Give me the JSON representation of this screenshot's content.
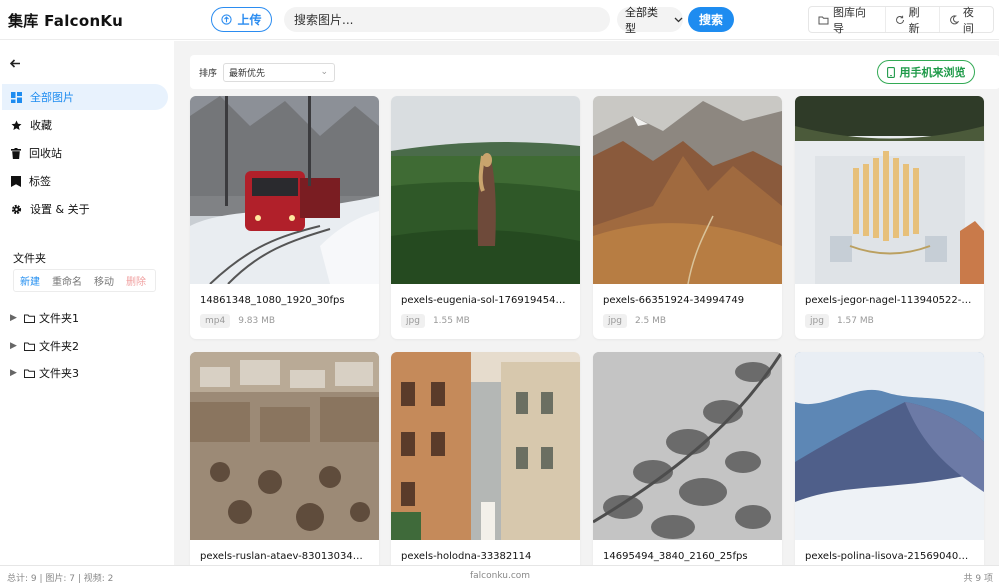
{
  "header": {
    "brand": "集库 FalconKu",
    "upload_label": "上传",
    "search_placeholder": "搜索图片...",
    "type_select": "全部类型",
    "search_button": "搜索",
    "toolbar": [
      {
        "label": "图库向导",
        "icon": "folder-icon"
      },
      {
        "label": "刷新",
        "icon": "refresh-icon"
      },
      {
        "label": "夜间",
        "icon": "moon-icon"
      }
    ]
  },
  "sidebar": {
    "nav": [
      {
        "label": "全部图片",
        "icon": "grid-icon",
        "active": true
      },
      {
        "label": "收藏",
        "icon": "star-icon"
      },
      {
        "label": "回收站",
        "icon": "trash-icon"
      },
      {
        "label": "标签",
        "icon": "tag-icon"
      },
      {
        "label": "设置 & 关于",
        "icon": "gear-icon"
      }
    ],
    "folder_title": "文件夹",
    "folder_actions": {
      "new": "新建",
      "rename": "重命名",
      "move": "移动",
      "delete": "删除"
    },
    "folders": [
      "文件夹1",
      "文件夹2",
      "文件夹3"
    ]
  },
  "toolbar2": {
    "sort_label": "排序",
    "sort_value": "最新优先",
    "mobile_button": "用手机来浏览"
  },
  "cards": [
    {
      "name": "14861348_1080_1920_30fps",
      "type": "mp4",
      "size": "9.83 MB"
    },
    {
      "name": "pexels-eugenia-sol-1769194548-3...",
      "type": "jpg",
      "size": "1.55 MB"
    },
    {
      "name": "pexels-66351924-34994749",
      "type": "jpg",
      "size": "2.5 MB"
    },
    {
      "name": "pexels-jegor-nagel-113940522-30...",
      "type": "jpg",
      "size": "1.57 MB"
    },
    {
      "name": "pexels-ruslan-ataev-830130344-1...",
      "type": "",
      "size": ""
    },
    {
      "name": "pexels-holodna-33382114",
      "type": "",
      "size": ""
    },
    {
      "name": "14695494_3840_2160_25fps",
      "type": "",
      "size": ""
    },
    {
      "name": "pexels-polina-lisova-2156904007-...",
      "type": "",
      "size": ""
    }
  ],
  "footer": {
    "stats": "总计: 9 | 图片: 7 | 视频: 2",
    "site": "falconku.com",
    "count": "共 9 项"
  }
}
